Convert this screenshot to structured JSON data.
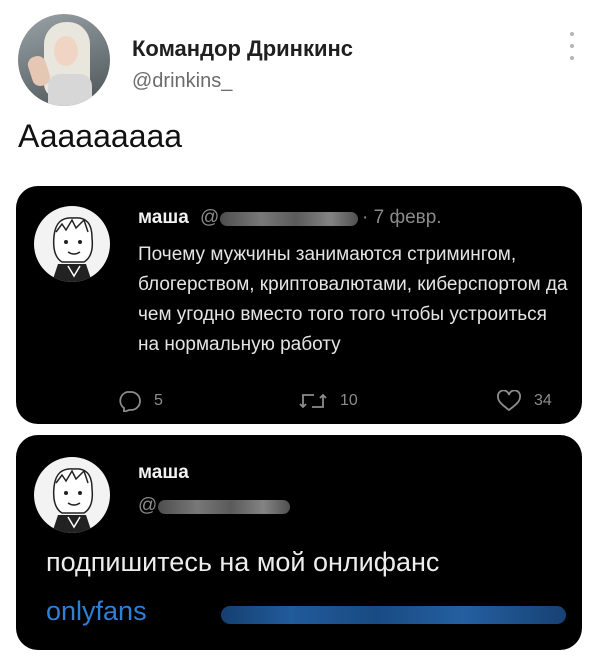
{
  "tweet": {
    "author_name": "Командор Дринкинс",
    "author_handle": "@drinkins_",
    "text": "Ааааааааа"
  },
  "quote1": {
    "name": "маша",
    "at": "@",
    "date": "· 7 февр.",
    "text": "Почему мужчины занимаются стримингом, блогерством, криптовалютами, киберспортом да чем угодно вместо того того чтобы устроиться на нормальную работу",
    "stats": {
      "replies": "5",
      "retweets": "10",
      "likes": "34"
    }
  },
  "quote2": {
    "name": "маша",
    "at": "@",
    "text": "подпишитесь на мой онлифанс",
    "link": "onlyfans"
  },
  "colors": {
    "link": "#2e7fd8",
    "card_bg": "#000000"
  },
  "icons": [
    "more-vertical-icon",
    "reply-icon",
    "retweet-icon",
    "like-icon"
  ]
}
